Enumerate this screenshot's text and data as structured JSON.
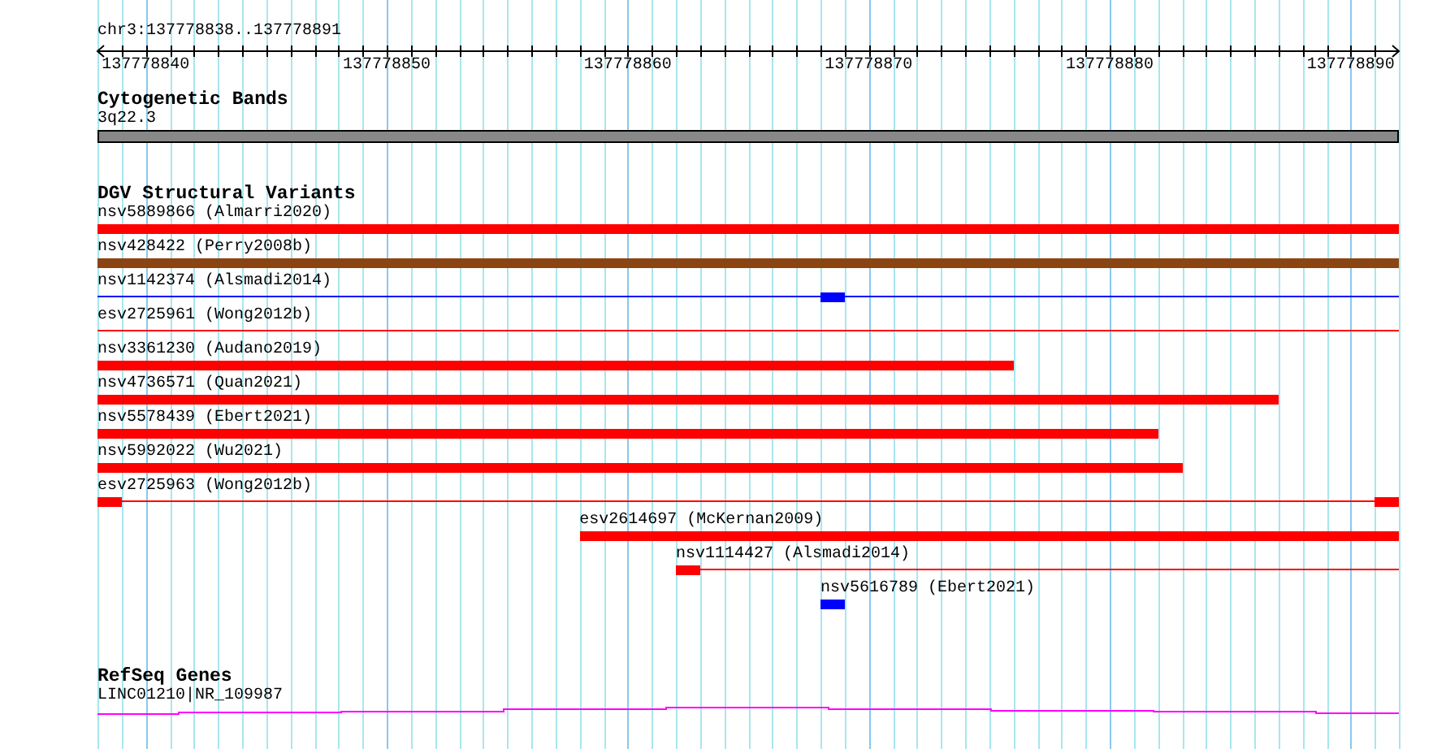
{
  "location": "chr3:137778838..137778891",
  "ruler": {
    "ticks": [
      "137778840",
      "137778850",
      "137778860",
      "137778870",
      "137778880",
      "137778890"
    ]
  },
  "tracks": [
    {
      "kind": "cytoband",
      "title": "Cytogenetic Bands",
      "features": [
        {
          "label": "3q22.3",
          "kind": "band",
          "color": "#888888"
        }
      ]
    },
    {
      "kind": "variants",
      "title": "DGV Structural Variants",
      "features": [
        {
          "label": "nsv5889866 (Almarri2020)",
          "kind": "bar",
          "color": "#ff0000"
        },
        {
          "label": "nsv428422 (Perry2008b)",
          "kind": "bar",
          "color": "#8b4513"
        },
        {
          "label": "nsv1142374 (Alsmadi2014)",
          "kind": "line",
          "color": "#0000ff"
        },
        {
          "label": "esv2725961 (Wong2012b)",
          "kind": "line",
          "color": "#ff0000"
        },
        {
          "label": "nsv3361230 (Audano2019)",
          "kind": "bar",
          "color": "#ff0000"
        },
        {
          "label": "nsv4736571 (Quan2021)",
          "kind": "bar",
          "color": "#ff0000"
        },
        {
          "label": "nsv5578439 (Ebert2021)",
          "kind": "bar",
          "color": "#ff0000"
        },
        {
          "label": "nsv5992022 (Wu2021)",
          "kind": "bar",
          "color": "#ff0000"
        },
        {
          "label": "esv2725963 (Wong2012b)",
          "kind": "line",
          "color": "#ff0000"
        },
        {
          "label": "esv2614697 (McKernan2009)",
          "kind": "bar",
          "color": "#ff0000"
        },
        {
          "label": "nsv1114427 (Alsmadi2014)",
          "kind": "line",
          "color": "#ff0000"
        },
        {
          "label": "nsv5616789 (Ebert2021)",
          "kind": "bar",
          "color": "#0000ff"
        }
      ]
    },
    {
      "kind": "genes",
      "title": "RefSeq Genes",
      "features": [
        {
          "label": "LINC01210|NR_109987",
          "kind": "gene",
          "color": "#ff00ff"
        }
      ]
    }
  ]
}
